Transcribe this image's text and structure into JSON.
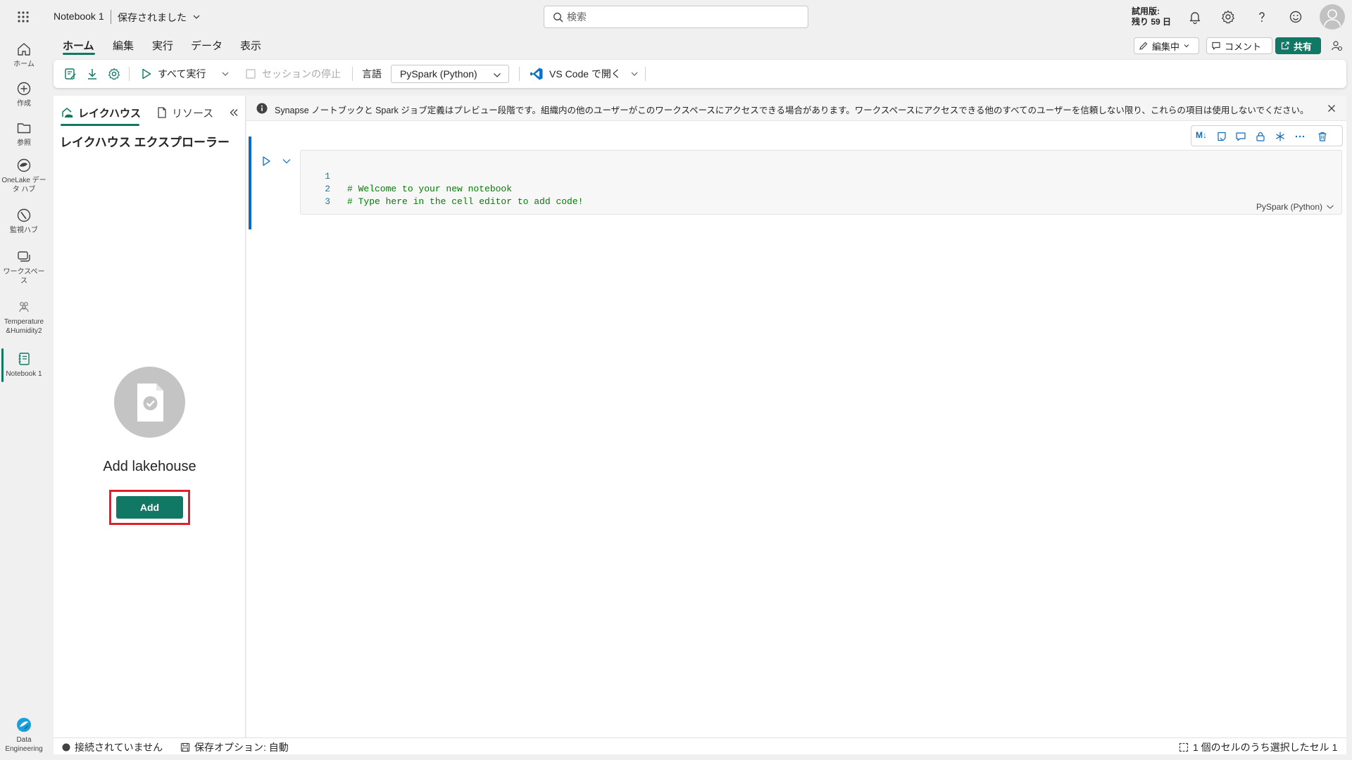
{
  "app": {
    "doc_title": "Notebook 1",
    "save_status": "保存されました",
    "search_placeholder": "検索",
    "trial_line1": "試用版:",
    "trial_line2": "残り 59 日"
  },
  "rail": {
    "items": [
      {
        "label": "ホーム",
        "icon": "home-icon"
      },
      {
        "label": "作成",
        "icon": "create-icon"
      },
      {
        "label": "参照",
        "icon": "folder-icon"
      },
      {
        "label": "OneLake データ ハブ",
        "icon": "onelake-icon"
      },
      {
        "label": "監視ハブ",
        "icon": "monitor-icon"
      },
      {
        "label": "ワークスペース",
        "icon": "workspace-icon"
      },
      {
        "label": "Temperature &Humidity2",
        "icon": "workspace-group-icon"
      },
      {
        "label": "Notebook 1",
        "icon": "notebook-icon",
        "active": true
      }
    ],
    "bottom_label": "Data Engineering"
  },
  "ribbon": {
    "tabs": [
      "ホーム",
      "編集",
      "実行",
      "データ",
      "表示"
    ],
    "active_tab": "ホーム",
    "editing_label": "編集中",
    "comment_label": "コメント",
    "share_label": "共有"
  },
  "toolbar": {
    "run_all_label": "すべて実行",
    "stop_session_label": "セッションの停止",
    "language_label": "言語",
    "language_value": "PySpark (Python)",
    "vscode_label": "VS Code で開く"
  },
  "lakehouse_panel": {
    "tab_lakehouse": "レイクハウス",
    "tab_resources": "リソース",
    "title": "レイクハウス エクスプローラー",
    "add_title": "Add lakehouse",
    "add_button": "Add"
  },
  "banner": {
    "text": "Synapse ノートブックと Spark ジョブ定義はプレビュー段階です。組織内の他のユーザーがこのワークスペースにアクセスできる場合があります。ワークスペースにアクセスできる他のすべてのユーザーを信頼しない限り、これらの項目は使用しないでください。"
  },
  "cell": {
    "toolbar_markdown_label": "M↓",
    "lines": [
      {
        "num": "1",
        "code": "# Welcome to your new notebook"
      },
      {
        "num": "2",
        "code": "# Type here in the cell editor to add code!"
      },
      {
        "num": "3",
        "code": ""
      }
    ],
    "language": "PySpark (Python)"
  },
  "status": {
    "connection": "接続されていません",
    "save_option": "保存オプション: 自動",
    "selection": "1 個のセルのうち選択したセル 1"
  },
  "colors": {
    "accent": "#117865",
    "cell_active_bar": "#0f6cbd",
    "highlight_border": "#e0202e",
    "code_comment": "#008000"
  }
}
